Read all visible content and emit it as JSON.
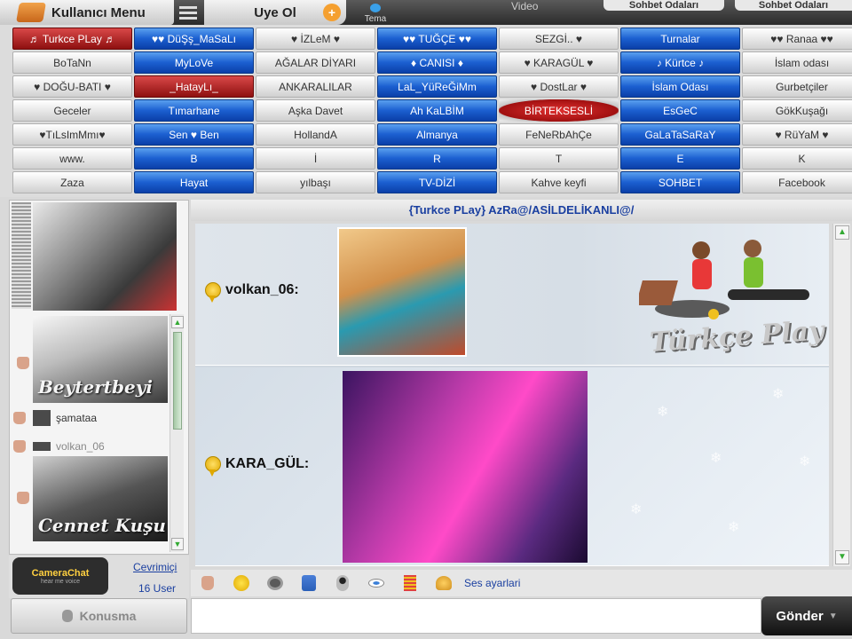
{
  "topbar": {
    "menu_label": "Kullanıcı Menu",
    "signup_label": "Uye Ol",
    "theme_label": "Tema",
    "video_label": "Video",
    "right_pill_1": "Sohbet Odaları",
    "right_pill_2": "Sohbet Odaları"
  },
  "rooms": [
    {
      "label": "♬ Turkce PLay ♬",
      "style": "red"
    },
    {
      "label": "♥♥ DüŞş_MaSaLı",
      "style": "blue"
    },
    {
      "label": "♥ İZLeM ♥",
      "style": "gray"
    },
    {
      "label": "♥♥ TUĞÇE ♥♥",
      "style": "blue"
    },
    {
      "label": "SEZGİ.. ♥",
      "style": "gray"
    },
    {
      "label": "Turnalar",
      "style": "blue"
    },
    {
      "label": "♥♥ Ranaa ♥♥",
      "style": "gray"
    },
    {
      "label": "BoTaNn",
      "style": "gray"
    },
    {
      "label": "MyLoVe",
      "style": "blue"
    },
    {
      "label": "AĞALAR DİYARI",
      "style": "gray"
    },
    {
      "label": "♦ CANISI ♦",
      "style": "blue"
    },
    {
      "label": "♥ KARAGÜL ♥",
      "style": "gray"
    },
    {
      "label": "♪ Kürtce ♪",
      "style": "blue"
    },
    {
      "label": "İslam odası",
      "style": "gray"
    },
    {
      "label": "♥ DOĞU-BATI ♥",
      "style": "gray"
    },
    {
      "label": "_HatayLı_",
      "style": "red"
    },
    {
      "label": "ANKARALILAR",
      "style": "gray"
    },
    {
      "label": "LaL_YüReĞiMm",
      "style": "blue"
    },
    {
      "label": "♥ DostLar ♥",
      "style": "gray"
    },
    {
      "label": "İslam Odası",
      "style": "blue"
    },
    {
      "label": "Gurbetçiler",
      "style": "gray"
    },
    {
      "label": "Geceler",
      "style": "gray"
    },
    {
      "label": "Tımarhane",
      "style": "blue"
    },
    {
      "label": "Aşka Davet",
      "style": "gray"
    },
    {
      "label": "Ah KaLBİM",
      "style": "blue"
    },
    {
      "label": "BİRTEKSESLİ",
      "style": "redpill"
    },
    {
      "label": "EsGeC",
      "style": "blue"
    },
    {
      "label": "GökKuşağı",
      "style": "gray"
    },
    {
      "label": "♥TıLsImMmı♥",
      "style": "gray"
    },
    {
      "label": "Sen ♥ Ben",
      "style": "blue"
    },
    {
      "label": "HollandA",
      "style": "gray"
    },
    {
      "label": "Almanya",
      "style": "blue"
    },
    {
      "label": "FeNeRbAhÇe",
      "style": "gray"
    },
    {
      "label": "GaLaTaSaRaY",
      "style": "blue"
    },
    {
      "label": "♥ RüYaM ♥",
      "style": "gray"
    },
    {
      "label": "www.",
      "style": "gray"
    },
    {
      "label": "B",
      "style": "blue"
    },
    {
      "label": "İ",
      "style": "gray"
    },
    {
      "label": "R",
      "style": "blue"
    },
    {
      "label": "T",
      "style": "gray"
    },
    {
      "label": "E",
      "style": "blue"
    },
    {
      "label": "K",
      "style": "gray"
    },
    {
      "label": "Zaza",
      "style": "gray"
    },
    {
      "label": "Hayat",
      "style": "blue"
    },
    {
      "label": "yılbaşı",
      "style": "gray"
    },
    {
      "label": "TV-DİZİ",
      "style": "blue"
    },
    {
      "label": "Kahve keyfi",
      "style": "gray"
    },
    {
      "label": "SOHBET",
      "style": "blue"
    },
    {
      "label": "Facebook",
      "style": "gray"
    }
  ],
  "userpanel": {
    "photo2_caption": "Beytertbeyi",
    "photo3_caption": "Cennet Kuşu",
    "users": [
      {
        "name": "şamataa",
        "dim": false
      },
      {
        "name": "volkan_06",
        "dim": true
      }
    ],
    "online_link": "Cevrimiçi",
    "user_count": "16 User",
    "logo_title": "CameraChat",
    "logo_sub": "hear me voice",
    "talk_button": "Konusma"
  },
  "chat": {
    "room_title": "{Turkce PLay}  AzRa@/ASİLDELİKANLI@/",
    "messages": [
      {
        "sender": "volkan_06:"
      },
      {
        "sender": "KARA_GÜL:"
      }
    ],
    "brand_text": "Türkçe Play"
  },
  "toolbar": {
    "icons": [
      "hand-icon",
      "smiley-icon",
      "film-icon",
      "person-icon",
      "webcam-icon",
      "eye-icon",
      "equalizer-icon",
      "bell-icon"
    ],
    "sound_settings": "Ses ayarlari"
  },
  "input": {
    "placeholder": "",
    "send_label": "Gönder"
  },
  "colors": {
    "room_blue": "#1b5fd0",
    "room_red": "#b01a1a",
    "link_blue": "#1a3fa0"
  }
}
